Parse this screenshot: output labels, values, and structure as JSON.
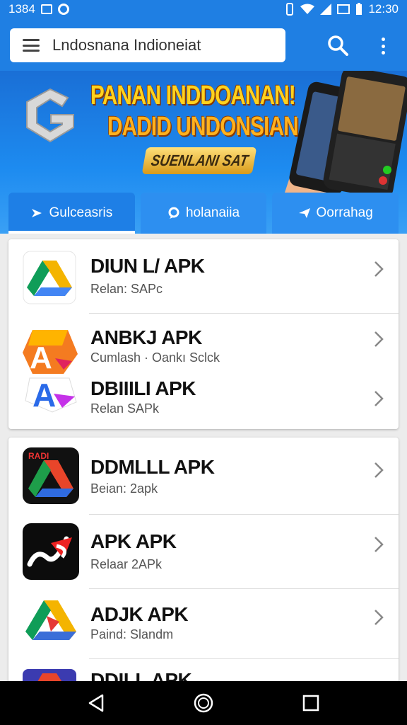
{
  "status_bar": {
    "time_left": "1384",
    "time_right": "12:30"
  },
  "search": {
    "value": "Lndosnana Indioneiat"
  },
  "banner": {
    "title_line1": "PANAN INDDOANAN!",
    "title_line2": "DADID UNDONSIAN",
    "badge": "SUENLANI SAT"
  },
  "tabs": [
    {
      "label": "Gulceasris",
      "icon": "play-icon",
      "active": true
    },
    {
      "label": "holanaiia",
      "icon": "pin-icon",
      "active": false
    },
    {
      "label": "Oorrahag",
      "icon": "send-icon",
      "active": false
    }
  ],
  "list1": [
    {
      "title": "DIUN L/ APK",
      "subtitle": "Relan: SAPc"
    },
    {
      "title": "ANBKJ APK",
      "subtitle": "Cumlash · Oankı Sclck"
    },
    {
      "title": "DBIIILI APK",
      "subtitle": "Relan SAPk"
    }
  ],
  "list2": [
    {
      "title": "DDMLLL APK",
      "subtitle": "Beian: 2apk",
      "icon_label": "RADI"
    },
    {
      "title": "APK APK",
      "subtitle": "Relaar 2APk"
    },
    {
      "title": "ADJK APK",
      "subtitle": "Paind: Slandm"
    },
    {
      "title": "DDILL APK",
      "subtitle": ""
    }
  ],
  "colors": {
    "primary": "#1f7fe3",
    "tab": "#2d8ff0",
    "banner_text": "#ffd21e"
  }
}
